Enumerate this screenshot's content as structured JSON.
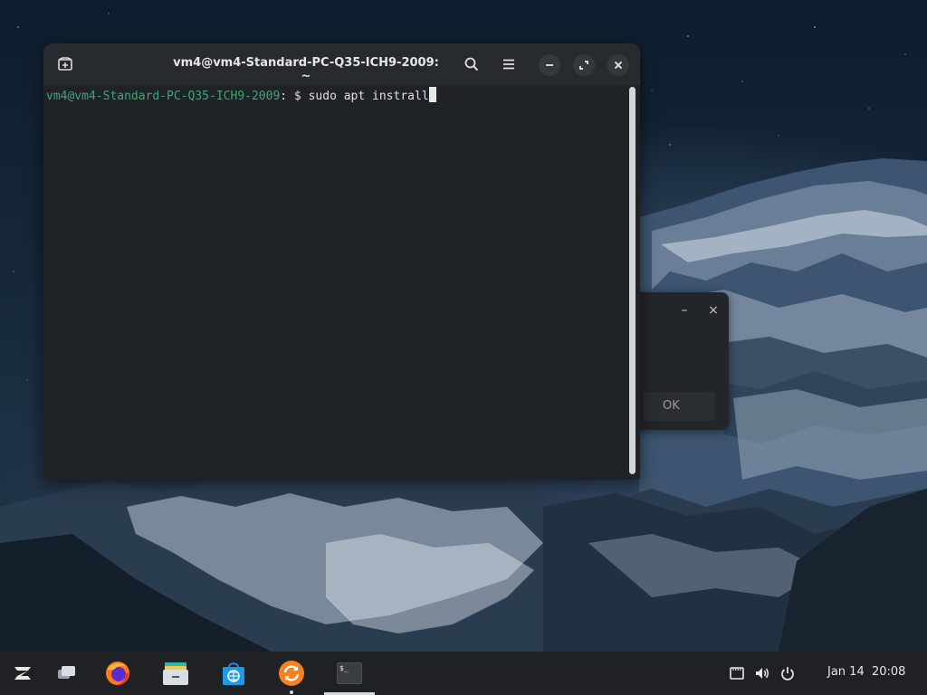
{
  "terminal": {
    "title": "vm4@vm4-Standard-PC-Q35-ICH9-2009: ~",
    "prompt_user": "vm4@vm4-Standard-PC-Q35-ICH9-2009",
    "prompt_sep": ":",
    "prompt_symbol": " $ ",
    "command": "sudo apt instrall",
    "icons": {
      "new_tab": "new-tab-icon",
      "search": "search-icon",
      "menu": "hamburger-menu-icon",
      "minimize": "minimize-icon",
      "maximize": "maximize-icon",
      "close": "close-icon"
    }
  },
  "dialog": {
    "ok_label": "OK",
    "minimize_glyph": "–",
    "close_glyph": "×"
  },
  "taskbar": {
    "apps": [
      {
        "name": "zorin-menu-icon"
      },
      {
        "name": "workspaces-icon"
      },
      {
        "name": "firefox-icon"
      },
      {
        "name": "files-icon"
      },
      {
        "name": "software-store-icon"
      },
      {
        "name": "software-updater-icon"
      },
      {
        "name": "terminal-icon"
      }
    ],
    "tray": {
      "network_icon": "network-icon",
      "volume_icon": "volume-icon",
      "power_icon": "power-icon"
    },
    "clock": "Jan 14  20:08"
  },
  "colors": {
    "prompt_green": "#3fa575",
    "terminal_bg": "#1f2327",
    "taskbar_bg": "#1f2124"
  }
}
